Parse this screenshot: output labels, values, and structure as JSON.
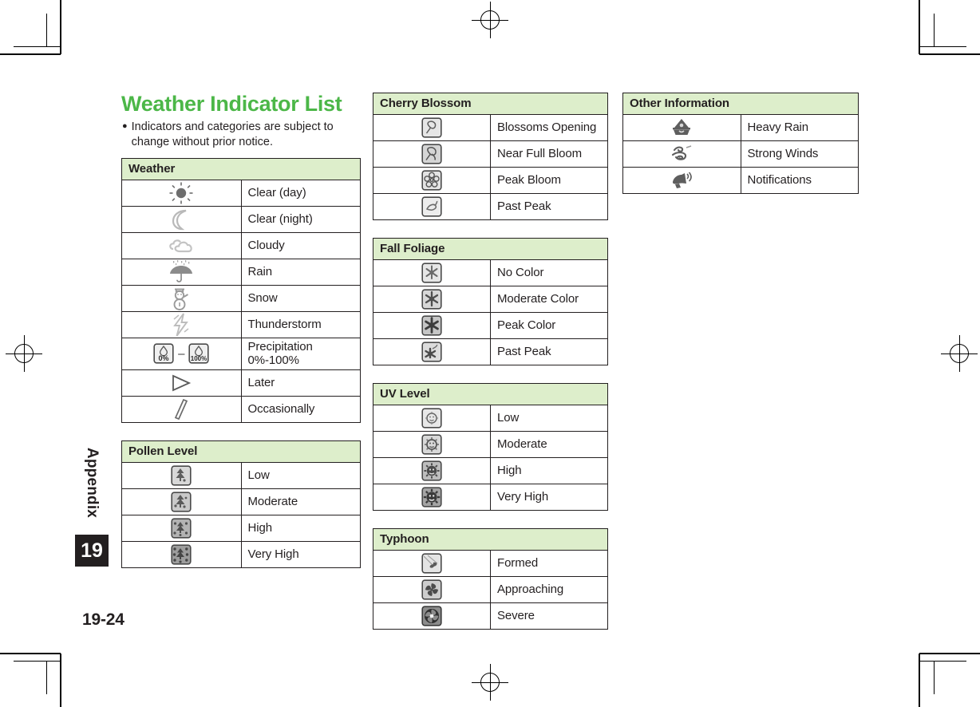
{
  "document": {
    "title": "Weather Indicator List",
    "title_color": "#4cb748",
    "note_bullet": "●",
    "note": "Indicators and categories are subject to change without prior notice.",
    "folio": "19-24",
    "side_tab_label": "Appendix",
    "chapter_number": "19",
    "header_bg": "#ddeecb"
  },
  "tables": {
    "weather": {
      "heading": "Weather",
      "rows": [
        {
          "icon": "sun-icon",
          "label": "Clear (day)"
        },
        {
          "icon": "moon-icon",
          "label": "Clear (night)"
        },
        {
          "icon": "cloud-icon",
          "label": "Cloudy"
        },
        {
          "icon": "umbrella-rain-icon",
          "label": "Rain"
        },
        {
          "icon": "snowman-icon",
          "label": "Snow"
        },
        {
          "icon": "lightning-bolt-icon",
          "label": "Thunderstorm"
        },
        {
          "icon": "precipitation-range-icon",
          "label": "Precipitation 0%-100%",
          "icon_text_min": "0%",
          "icon_text_max": "100%",
          "icon_separator": "–"
        },
        {
          "icon": "play-triangle-icon",
          "label": "Later"
        },
        {
          "icon": "slash-bar-icon",
          "label": "Occasionally"
        }
      ]
    },
    "pollen": {
      "heading": "Pollen Level",
      "rows": [
        {
          "icon": "pollen-low-icon",
          "label": "Low"
        },
        {
          "icon": "pollen-moderate-icon",
          "label": "Moderate"
        },
        {
          "icon": "pollen-high-icon",
          "label": "High"
        },
        {
          "icon": "pollen-very-high-icon",
          "label": "Very High"
        }
      ]
    },
    "cherry_blossom": {
      "heading": "Cherry Blossom",
      "rows": [
        {
          "icon": "blossom-bud-icon",
          "label": "Blossoms Opening"
        },
        {
          "icon": "blossom-near-full-icon",
          "label": "Near Full Bloom"
        },
        {
          "icon": "blossom-peak-icon",
          "label": "Peak Bloom"
        },
        {
          "icon": "blossom-past-peak-icon",
          "label": "Past Peak"
        }
      ]
    },
    "fall_foliage": {
      "heading": "Fall Foliage",
      "rows": [
        {
          "icon": "leaf-no-color-icon",
          "label": "No Color"
        },
        {
          "icon": "leaf-moderate-color-icon",
          "label": "Moderate Color"
        },
        {
          "icon": "leaf-peak-color-icon",
          "label": "Peak Color"
        },
        {
          "icon": "leaf-past-peak-icon",
          "label": "Past Peak"
        }
      ]
    },
    "uv_level": {
      "heading": "UV Level",
      "rows": [
        {
          "icon": "uv-low-icon",
          "label": "Low"
        },
        {
          "icon": "uv-moderate-icon",
          "label": "Moderate"
        },
        {
          "icon": "uv-high-icon",
          "label": "High"
        },
        {
          "icon": "uv-very-high-icon",
          "label": "Very High"
        }
      ]
    },
    "typhoon": {
      "heading": "Typhoon",
      "rows": [
        {
          "icon": "typhoon-formed-icon",
          "label": "Formed"
        },
        {
          "icon": "typhoon-approaching-icon",
          "label": "Approaching"
        },
        {
          "icon": "typhoon-severe-icon",
          "label": "Severe"
        }
      ]
    },
    "other_information": {
      "heading": "Other Information",
      "rows": [
        {
          "icon": "heavy-rain-icon",
          "label": "Heavy Rain"
        },
        {
          "icon": "strong-winds-icon",
          "label": "Strong Winds"
        },
        {
          "icon": "notifications-megaphone-icon",
          "label": "Notifications"
        }
      ]
    }
  }
}
